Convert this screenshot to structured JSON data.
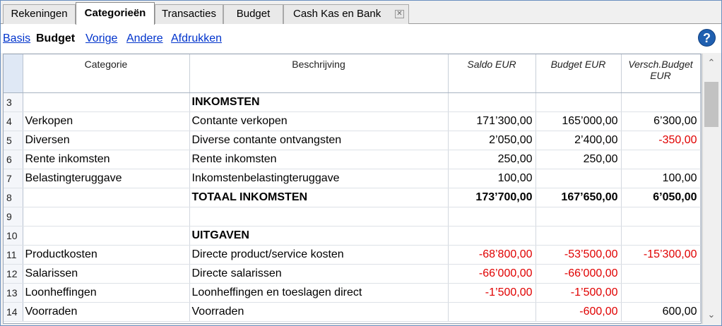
{
  "tabs": [
    {
      "label": "Rekeningen",
      "active": false
    },
    {
      "label": "Categorieën",
      "active": true
    },
    {
      "label": "Transacties",
      "active": false
    },
    {
      "label": "Budget",
      "active": false
    },
    {
      "label": "Cash Kas en Bank",
      "active": false,
      "closable": true
    }
  ],
  "links": [
    {
      "label": "Basis",
      "current": false
    },
    {
      "label": "Budget",
      "current": true
    },
    {
      "label": "Vorige",
      "current": false
    },
    {
      "label": "Andere",
      "current": false
    },
    {
      "label": "Afdrukken",
      "current": false
    }
  ],
  "help_label": "?",
  "columns": {
    "categorie": "Categorie",
    "beschrijving": "Beschrijving",
    "saldo": "Saldo EUR",
    "budget": "Budget EUR",
    "versch_line1": "Versch.Budget",
    "versch_line2": "EUR"
  },
  "rows": [
    {
      "nr": "3",
      "categorie": "",
      "beschrijving": "INKOMSTEN",
      "saldo": "",
      "budget": "",
      "versch": "",
      "bold": true
    },
    {
      "nr": "4",
      "categorie": "Verkopen",
      "beschrijving": "Contante verkopen",
      "saldo": "171’300,00",
      "budget": "165’000,00",
      "versch": "6’300,00"
    },
    {
      "nr": "5",
      "categorie": "Diversen",
      "beschrijving": "Diverse contante ontvangsten",
      "saldo": "2’050,00",
      "budget": "2’400,00",
      "versch": "-350,00"
    },
    {
      "nr": "6",
      "categorie": "Rente inkomsten",
      "beschrijving": "Rente inkomsten",
      "saldo": "250,00",
      "budget": "250,00",
      "versch": ""
    },
    {
      "nr": "7",
      "categorie": "Belastingteruggave",
      "beschrijving": "Inkomstenbelastingteruggave",
      "saldo": "100,00",
      "budget": "",
      "versch": "100,00"
    },
    {
      "nr": "8",
      "categorie": "",
      "beschrijving": "TOTAAL INKOMSTEN",
      "saldo": "173’700,00",
      "budget": "167’650,00",
      "versch": "6’050,00",
      "bold": true
    },
    {
      "nr": "9",
      "categorie": "",
      "beschrijving": "",
      "saldo": "",
      "budget": "",
      "versch": ""
    },
    {
      "nr": "10",
      "categorie": "",
      "beschrijving": "UITGAVEN",
      "saldo": "",
      "budget": "",
      "versch": "",
      "bold": true
    },
    {
      "nr": "11",
      "categorie": "Productkosten",
      "beschrijving": "Directe product/service kosten",
      "saldo": "-68’800,00",
      "budget": "-53’500,00",
      "versch": "-15’300,00"
    },
    {
      "nr": "12",
      "categorie": "Salarissen",
      "beschrijving": "Directe salarissen",
      "saldo": "-66’000,00",
      "budget": "-66’000,00",
      "versch": ""
    },
    {
      "nr": "13",
      "categorie": "Loonheffingen",
      "beschrijving": "Loonheffingen en toeslagen direct",
      "saldo": "-1’500,00",
      "budget": "-1’500,00",
      "versch": ""
    },
    {
      "nr": "14",
      "categorie": "Voorraden",
      "beschrijving": "Voorraden",
      "saldo": "",
      "budget": "-600,00",
      "versch": "600,00"
    }
  ],
  "colors": {
    "negative": "#e00000",
    "link": "#0033cc",
    "help": "#1f5fb0"
  }
}
